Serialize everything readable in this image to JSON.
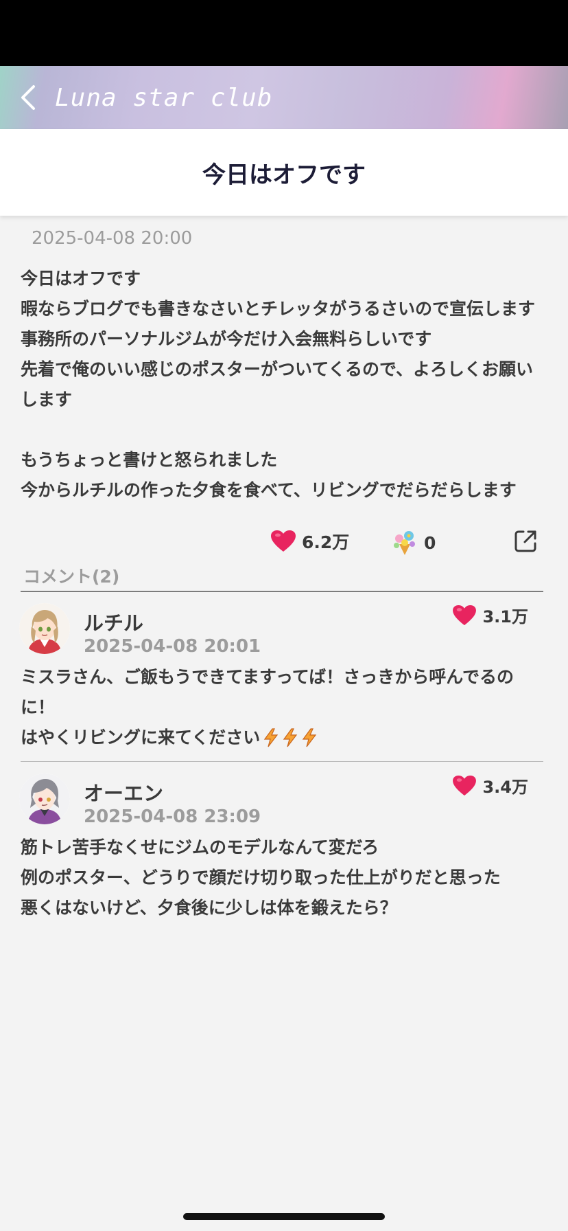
{
  "header": {
    "title": "Luna star club"
  },
  "page": {
    "title": "今日はオフです"
  },
  "post": {
    "date": "2025-04-08 20:00",
    "lines": [
      "今日はオフです",
      "暇ならブログでも書きなさいとチレッタがうるさいので宣伝します",
      "事務所のパーソナルジムが今だけ入会無料らしいです",
      "先着で俺のいい感じのポスターがついてくるので、よろしくお願い",
      "します",
      "",
      "もうちょっと書けと怒られました",
      "今からルチルの作った夕食を食べて、リビングでだらだらします"
    ],
    "likes": "6.2万",
    "gifts": "0"
  },
  "comments": {
    "label": "コメント(2)",
    "items": [
      {
        "name": "ルチル",
        "date": "2025-04-08 20:01",
        "likes": "3.1万",
        "lines": [
          "ミスラさん、ご飯もうできてますってば！さっきから呼んでるの",
          "に！",
          "はやくリビングに来てください"
        ]
      },
      {
        "name": "オーエン",
        "date": "2025-04-08 23:09",
        "likes": "3.4万",
        "lines": [
          "筋トレ苦手なくせにジムのモデルなんて変だろ",
          "例のポスター、どうりで顔だけ切り取った仕上がりだと思った",
          "悪くはないけど、夕食後に少しは体を鍛えたら？"
        ]
      }
    ]
  },
  "colors": {
    "heart": "#e8245f",
    "text": "#3a3a3a",
    "muted": "#9c9c9c",
    "title": "#1c1c36"
  },
  "icons": {
    "back": "chevron-left-icon",
    "like": "heart-icon",
    "gift": "flower-bouquet-icon",
    "share": "share-external-icon",
    "emoji": "zap-icon"
  }
}
